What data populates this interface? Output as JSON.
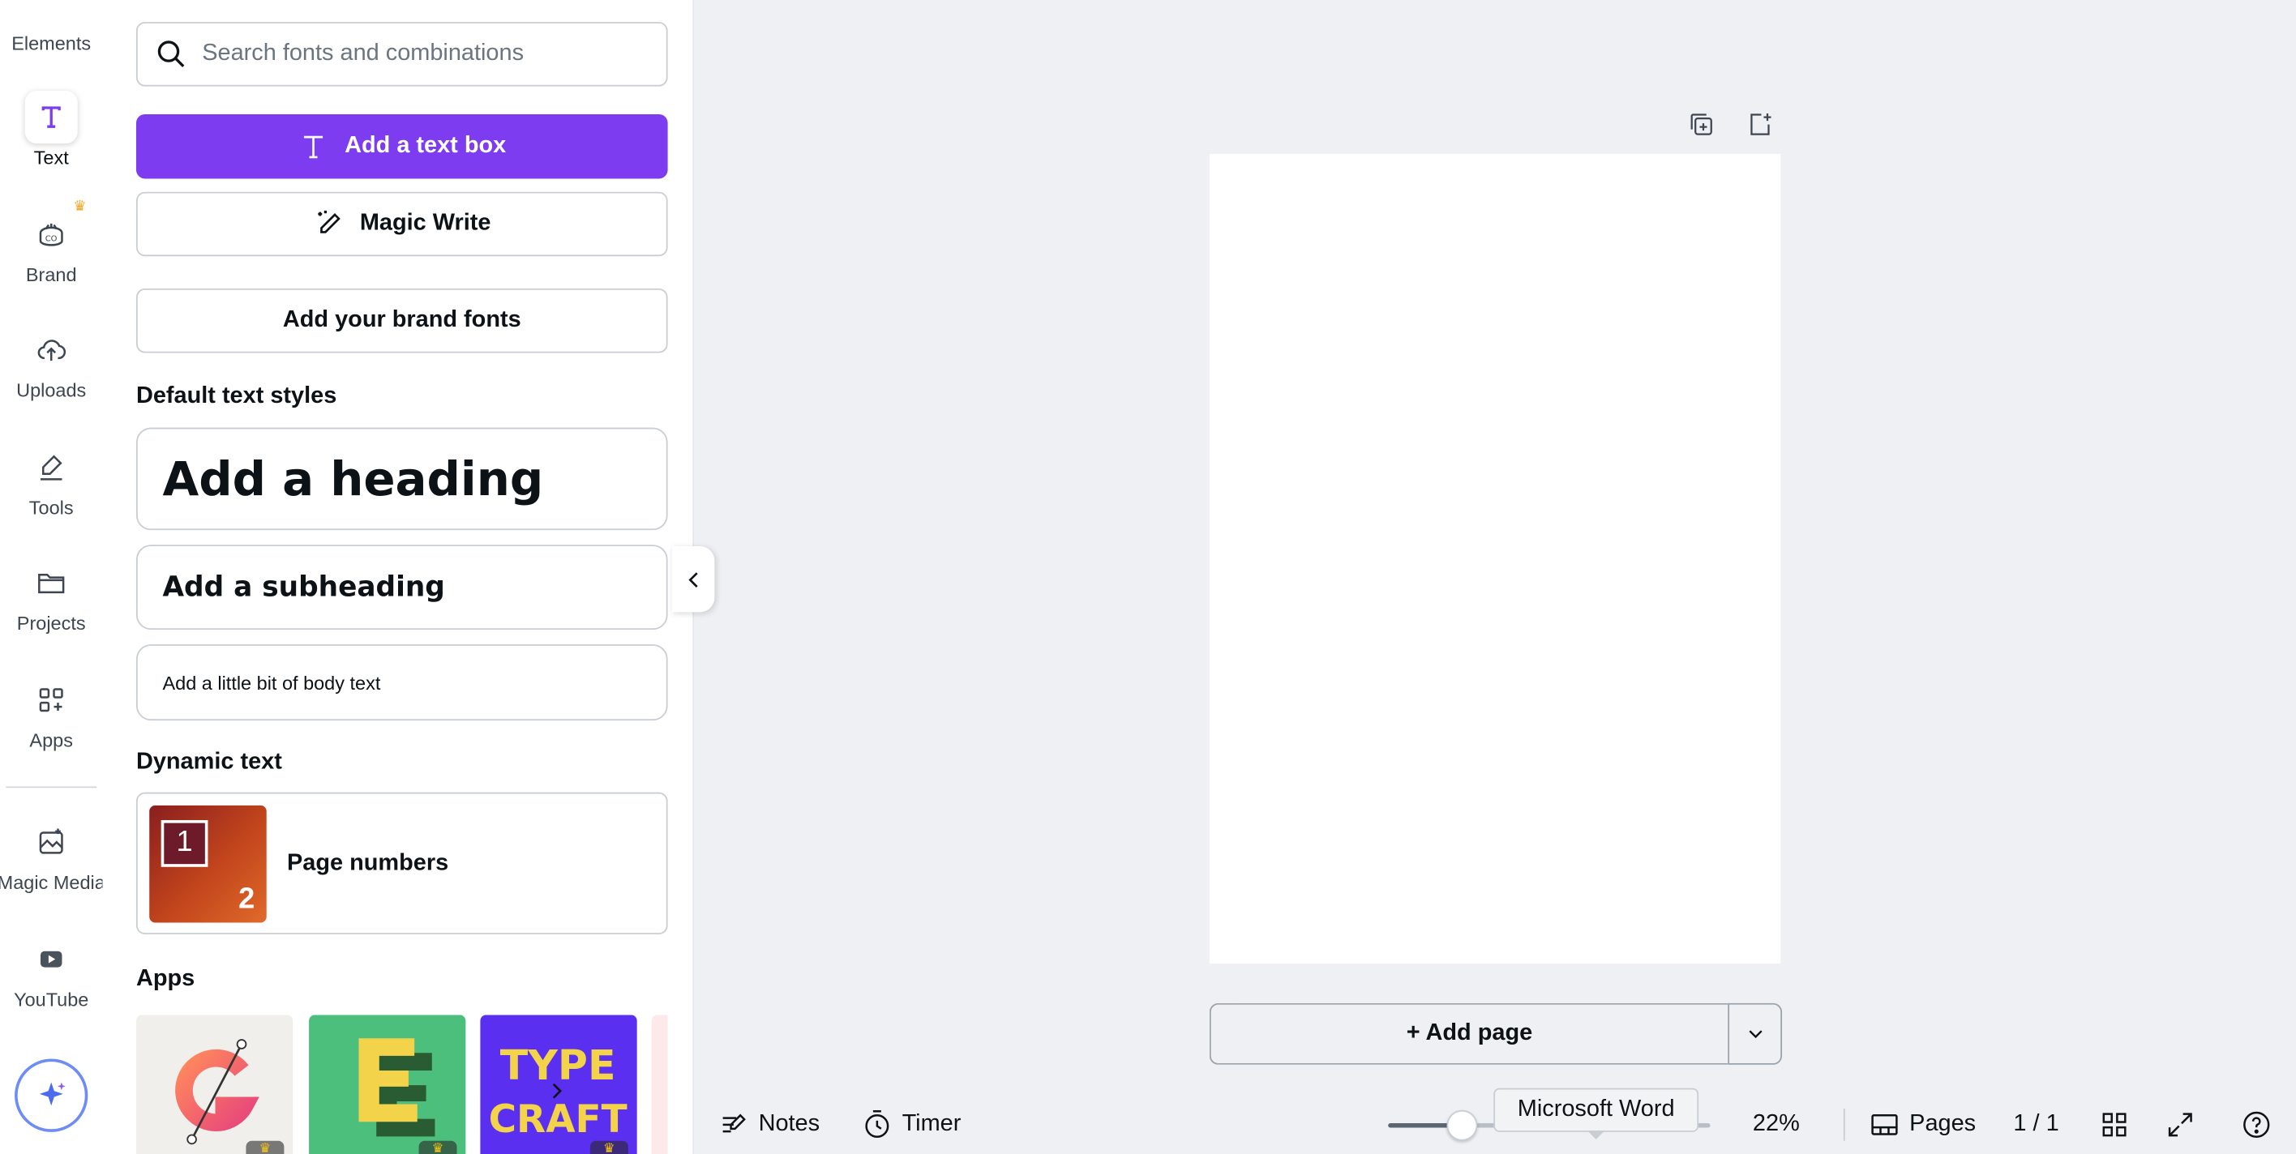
{
  "rail": {
    "items": [
      {
        "label": "Elements",
        "icon": "elements-icon"
      },
      {
        "label": "Text",
        "icon": "text-icon"
      },
      {
        "label": "Brand",
        "icon": "brand-icon"
      },
      {
        "label": "Uploads",
        "icon": "upload-cloud-icon"
      },
      {
        "label": "Tools",
        "icon": "pen-tool-icon"
      },
      {
        "label": "Projects",
        "icon": "folder-icon"
      },
      {
        "label": "Apps",
        "icon": "apps-grid-icon"
      },
      {
        "label": "Magic Media",
        "icon": "magic-media-icon"
      },
      {
        "label": "YouTube",
        "icon": "youtube-icon"
      }
    ],
    "active": "Text"
  },
  "panel": {
    "search_placeholder": "Search fonts and combinations",
    "add_text_box": "Add a text box",
    "magic_write": "Magic Write",
    "add_brand_fonts": "Add your brand fonts",
    "default_styles_title": "Default text styles",
    "heading": "Add a heading",
    "subheading": "Add a subheading",
    "body": "Add a little bit of body text",
    "dynamic_title": "Dynamic text",
    "page_numbers": "Page numbers",
    "thumb_num1": "1",
    "thumb_num2": "2",
    "apps_title": "Apps",
    "app_tiles": [
      {
        "letter": "G"
      },
      {
        "letter": "E"
      },
      {
        "letter": "TYPE CRAFT"
      }
    ]
  },
  "canvas": {
    "add_page": "+ Add page"
  },
  "bottombar": {
    "notes": "Notes",
    "timer": "Timer",
    "tooltip": "Microsoft Word",
    "zoom": "22%",
    "pages": "Pages",
    "page_count": "1 / 1"
  },
  "colors": {
    "accent": "#7d3cf0",
    "background": "#eef0f4"
  }
}
